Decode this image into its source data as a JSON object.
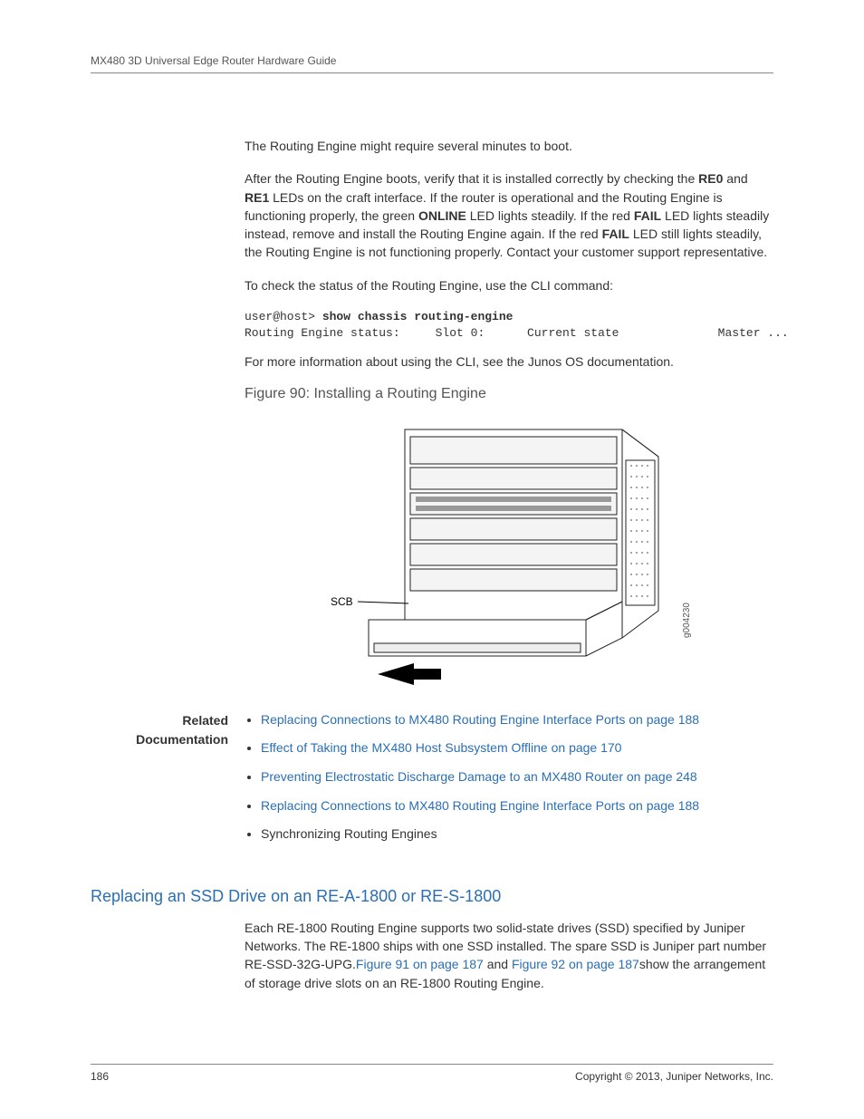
{
  "header": {
    "running_head": "MX480 3D Universal Edge Router Hardware Guide"
  },
  "body": {
    "p1": "The Routing Engine might require several minutes to boot.",
    "p2_a": "After the Routing Engine boots, verify that it is installed correctly by checking the ",
    "p2_re0": "RE0",
    "p2_b": " and ",
    "p2_re1": "RE1",
    "p2_c": " LEDs on the craft interface. If the router is operational and the Routing Engine is functioning properly, the green ",
    "p2_online": "ONLINE",
    "p2_d": " LED lights steadily. If the red ",
    "p2_fail1": "FAIL",
    "p2_e": " LED lights steadily instead, remove and install the Routing Engine again. If the red ",
    "p2_fail2": "FAIL",
    "p2_f": " LED still lights steadily, the Routing Engine is not functioning properly. Contact your customer support representative.",
    "p3": "To check the status of the Routing Engine, use the CLI command:",
    "cli": {
      "prompt": "user@host>",
      "command": " show chassis routing-engine",
      "line2": "Routing Engine status:     Slot 0:      Current state              Master ..."
    },
    "p4": "For more information about using the CLI, see the Junos OS documentation.",
    "figure": {
      "title": "Figure 90: Installing a Routing Engine",
      "label_scb": "SCB",
      "id": "g004230"
    }
  },
  "related": {
    "label_l1": "Related",
    "label_l2": "Documentation",
    "items": [
      {
        "text": "Replacing Connections to MX480 Routing Engine Interface Ports on page 188",
        "link": true
      },
      {
        "text": "Effect of Taking the MX480 Host Subsystem Offline on page 170",
        "link": true
      },
      {
        "text": "Preventing Electrostatic Discharge Damage to an MX480 Router on page 248",
        "link": true
      },
      {
        "text": "Replacing Connections to MX480 Routing Engine Interface Ports on page 188",
        "link": true
      },
      {
        "text": "Synchronizing Routing Engines",
        "link": false
      }
    ]
  },
  "section": {
    "title": "Replacing an SSD Drive on an RE-A-1800 or RE-S-1800",
    "p_a": "Each RE-1800 Routing Engine supports two solid-state drives (SSD) specified by Juniper Networks. The RE-1800 ships with one SSD installed. The spare SSD is Juniper part number RE-SSD-32G-UPG.",
    "link1": "Figure 91 on page 187",
    "p_b": " and ",
    "link2": "Figure 92 on page 187",
    "p_c": "show the arrangement of storage drive slots on an RE-1800 Routing Engine."
  },
  "footer": {
    "page": "186",
    "copyright": "Copyright © 2013, Juniper Networks, Inc."
  }
}
